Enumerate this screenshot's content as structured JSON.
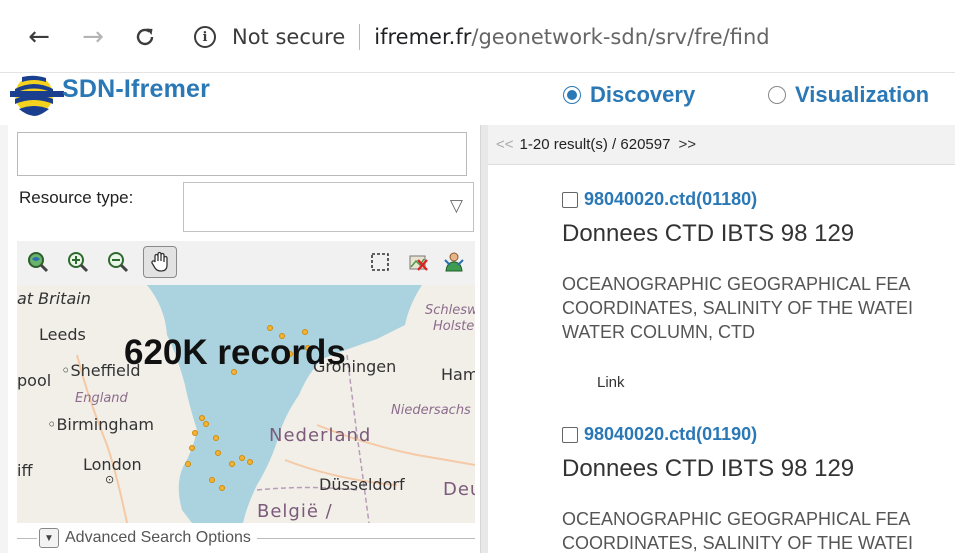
{
  "browser": {
    "back_icon": "←",
    "forward_icon": "→",
    "reload_icon": "C",
    "security_text": "Not secure",
    "url_domain": "ifremer.fr",
    "url_path": "/geonetwork-sdn/srv/fre/find"
  },
  "header": {
    "logo_text": "SDN-Ifremer",
    "modes": [
      {
        "label": "Discovery",
        "selected": true
      },
      {
        "label": "Visualization",
        "selected": false
      }
    ]
  },
  "search": {
    "value": "",
    "resource_type_label": "Resource type:",
    "resource_type_value": ""
  },
  "map": {
    "overlay": "620K records",
    "labels": {
      "great_britain": "at Britain",
      "leeds": "Leeds",
      "sheffield": "Sheffield",
      "pool": "pool",
      "england": "England",
      "birmingham": "Birmingham",
      "london": "London",
      "iff": "iff",
      "schleswig": "Schlesw",
      "holstein": "Holste",
      "groningen": "Groningen",
      "ham": "Ham",
      "niedersachsen": "Niedersachs",
      "nederland": "Nederland",
      "dusseldorf": "Düsseldorf",
      "deu": "Deu",
      "belgie": "België /"
    }
  },
  "advanced": {
    "label": "Advanced Search Options",
    "toggle_icon": "▼"
  },
  "results": {
    "pager_prev": "<<",
    "pager_text": "1-20 result(s) / 620597",
    "pager_next": ">>",
    "records": [
      {
        "id": "98040020.ctd(01180)",
        "title": "Donnees CTD IBTS 98 129",
        "keywords": [
          "OCEANOGRAPHIC GEOGRAPHICAL FEA",
          "COORDINATES, SALINITY OF THE WATEI",
          "WATER COLUMN, CTD"
        ],
        "link_label": "Link"
      },
      {
        "id": "98040020.ctd(01190)",
        "title": "Donnees CTD IBTS 98 129",
        "keywords": [
          "OCEANOGRAPHIC GEOGRAPHICAL FEA",
          "COORDINATES, SALINITY OF THE WATEI"
        ]
      }
    ]
  },
  "colors": {
    "accent": "#2a78b6",
    "sea": "#aad3df",
    "land": "#f2efe9",
    "marker": "#f2b33a"
  }
}
